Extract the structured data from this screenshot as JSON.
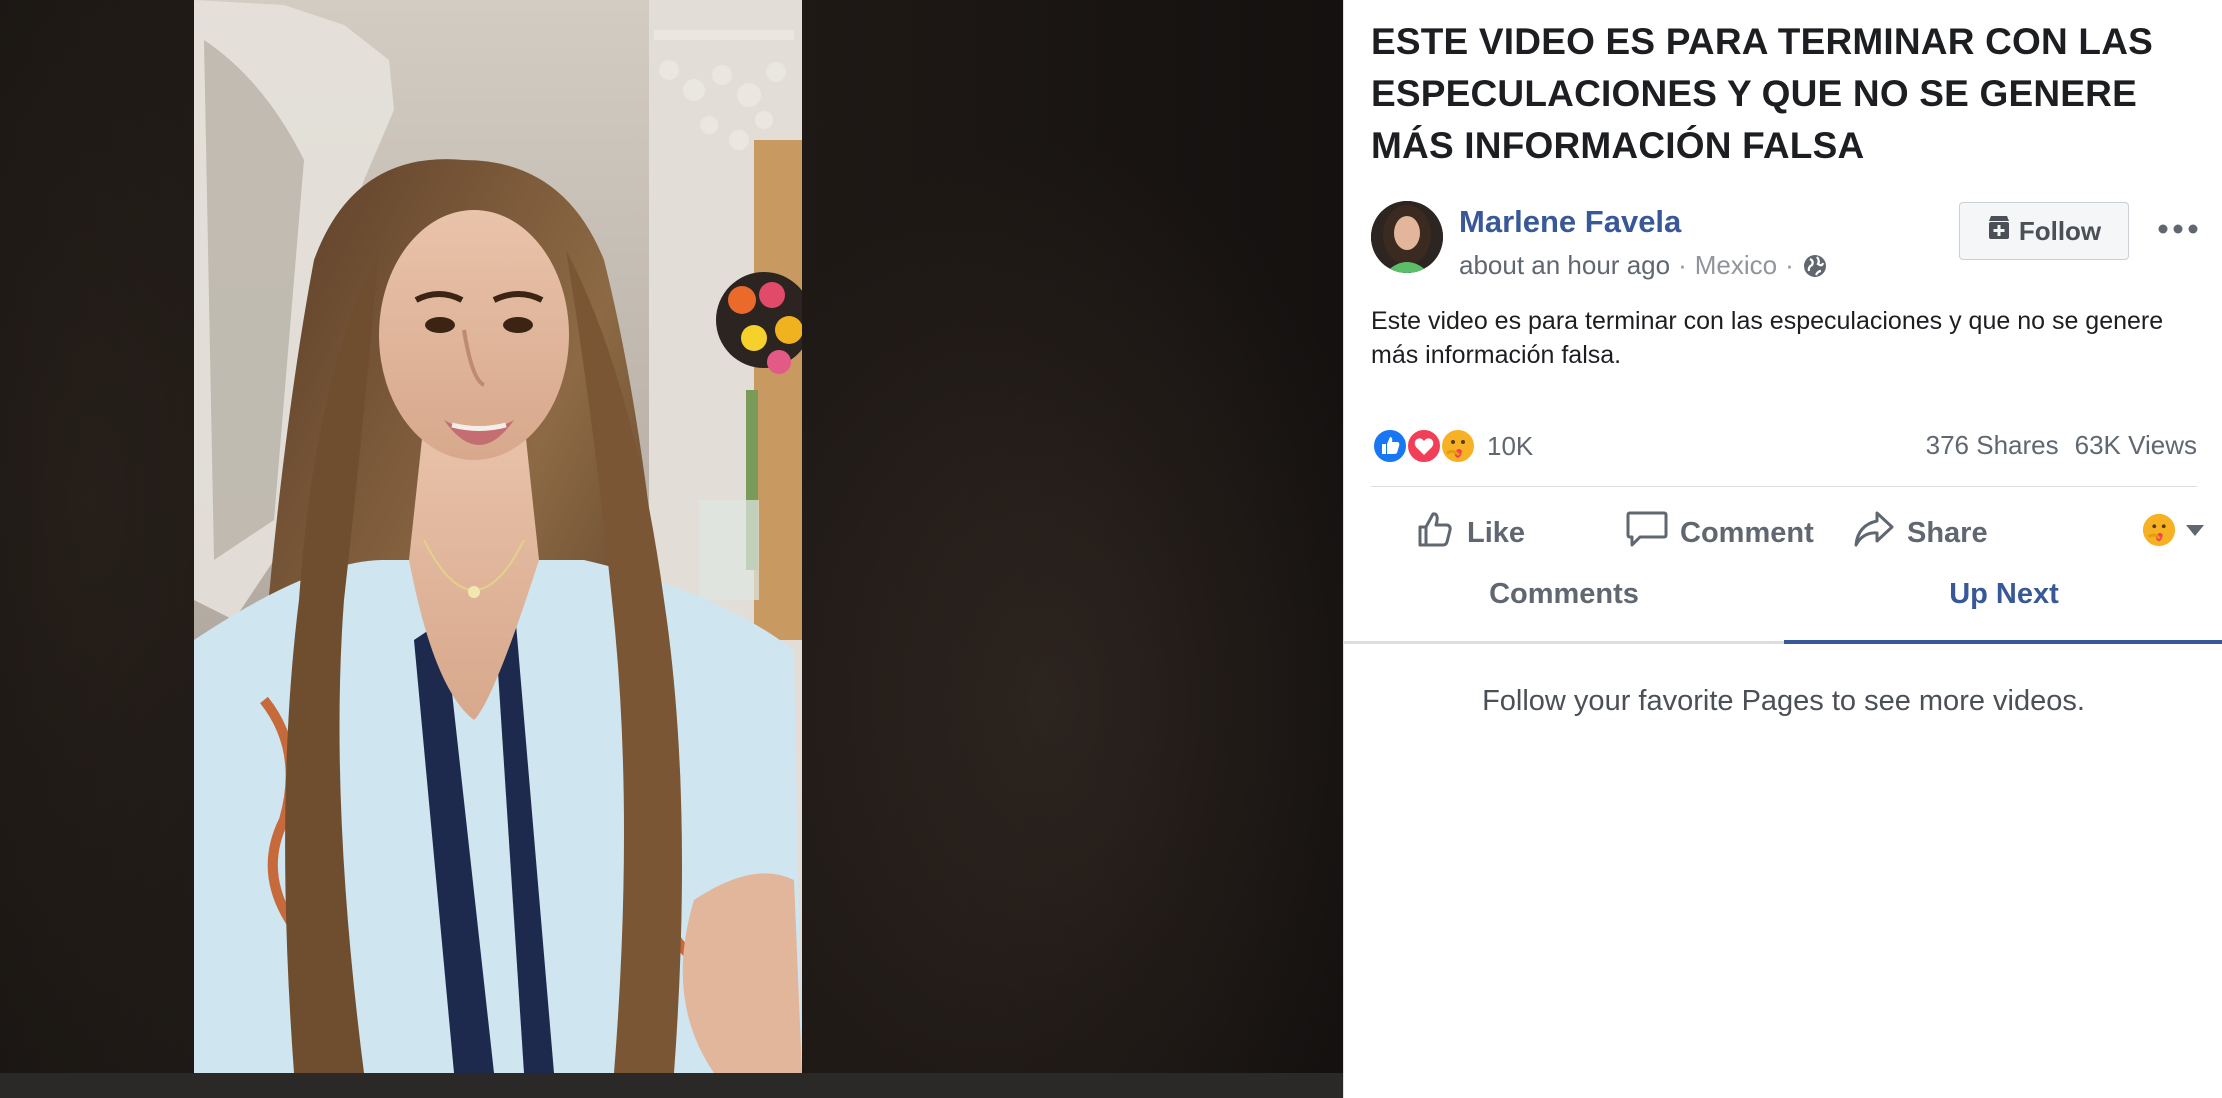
{
  "post": {
    "title": "ESTE VIDEO ES PARA TERMINAR CON LAS ESPECULACIONES Y QUE NO SE GENERE MÁS INFORMACIÓN FALSA",
    "author": "Marlene Favela",
    "time": "about an hour ago",
    "separator": "·",
    "location": "Mexico",
    "text": "Este video es para terminar con las especulaciones y que no se genere más información falsa."
  },
  "follow": {
    "label": "Follow"
  },
  "engagement": {
    "reactions_count": "10K",
    "shares": "376 Shares",
    "views": "63K Views"
  },
  "actions": {
    "like": "Like",
    "comment": "Comment",
    "share": "Share"
  },
  "tabs": {
    "comments": "Comments",
    "up_next": "Up Next",
    "active": "up_next"
  },
  "up_next": {
    "empty_message": "Follow your favorite Pages to see more videos."
  },
  "icons": {
    "globe": "globe-icon",
    "follow": "follow-page-icon",
    "more": "more-options-icon",
    "like": "like-icon",
    "comment": "comment-icon",
    "share": "share-icon",
    "reaction_like": "like-reaction-icon",
    "reaction_love": "love-reaction-icon",
    "reaction_care": "care-reaction-icon"
  },
  "colors": {
    "link_blue": "#385898",
    "text_primary": "#1c1e21",
    "text_secondary": "#606770",
    "like_blue": "#1877f2",
    "love_red": "#f33e58",
    "care_yellow": "#f7b125"
  }
}
